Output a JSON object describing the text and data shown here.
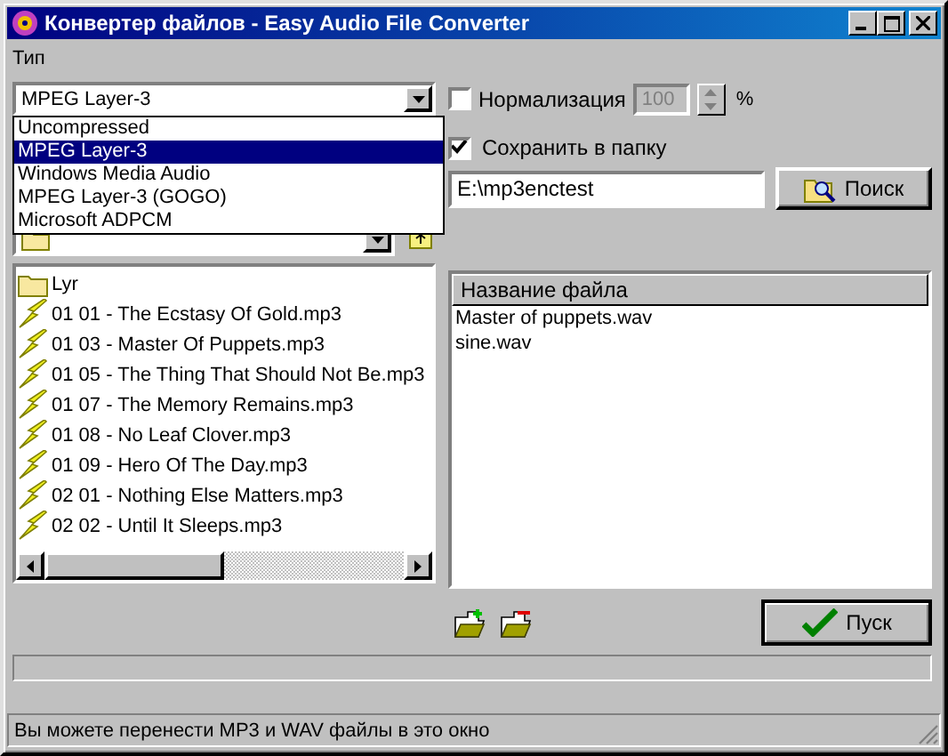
{
  "window": {
    "title": "Конвертер файлов - Easy Audio File Converter"
  },
  "type": {
    "label": "Тип",
    "value": "MPEG Layer-3",
    "expanded": true,
    "options": [
      {
        "label": "Uncompressed",
        "selected": false
      },
      {
        "label": "MPEG Layer-3",
        "selected": true
      },
      {
        "label": "Windows Media Audio",
        "selected": false
      },
      {
        "label": "MPEG Layer-3 (GOGO)",
        "selected": false
      },
      {
        "label": "Microsoft ADPCM",
        "selected": false
      }
    ]
  },
  "normalize": {
    "label": "Нормализация",
    "checked": false,
    "value": "100",
    "disabled": true,
    "unit": "%"
  },
  "save_to_folder": {
    "label": "Сохранить в папку",
    "checked": true
  },
  "folder_path": "E:\\mp3enctest",
  "browse_button": "Поиск",
  "browser_items": [
    {
      "kind": "folder",
      "name": "Lyr"
    },
    {
      "kind": "file",
      "name": "01 01 - The Ecstasy Of Gold.mp3"
    },
    {
      "kind": "file",
      "name": "01 03 - Master Of Puppets.mp3"
    },
    {
      "kind": "file",
      "name": "01 05 - The Thing That Should Not Be.mp3"
    },
    {
      "kind": "file",
      "name": "01 07 - The Memory Remains.mp3"
    },
    {
      "kind": "file",
      "name": "01 08 - No Leaf Clover.mp3"
    },
    {
      "kind": "file",
      "name": "01 09 - Hero Of The Day.mp3"
    },
    {
      "kind": "file",
      "name": "02 01 - Nothing Else Matters.mp3"
    },
    {
      "kind": "file",
      "name": "02 02 - Until It Sleeps.mp3"
    }
  ],
  "file_table": {
    "columns": [
      "Название файла"
    ],
    "rows": [
      "Master of puppets.wav",
      "sine.wav"
    ]
  },
  "start_button": "Пуск",
  "progress": {
    "level": 0
  },
  "status_bar": "Вы можете перенести MP3 и WAV файлы в это окно"
}
